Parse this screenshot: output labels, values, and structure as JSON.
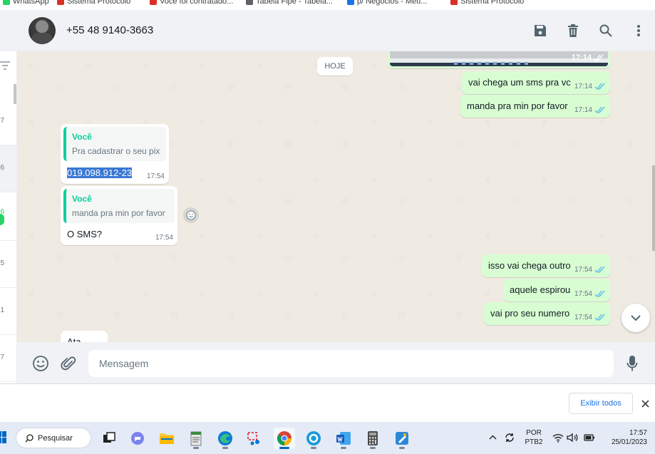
{
  "bookmarks": [
    {
      "label": "WhatsApp",
      "color": "#25d366"
    },
    {
      "label": "Sistema Protocolo",
      "color": "#d93025"
    },
    {
      "label": "Voce foi contratado...",
      "color": "#d93025"
    },
    {
      "label": "Tabela Fipe - Tabela...",
      "color": "#5f6368"
    },
    {
      "label": "p/ Negocios - Meu...",
      "color": "#1a73e8"
    },
    {
      "label": "Sistema Protocolo",
      "color": "#d93025"
    }
  ],
  "chat_list": {
    "times": [
      "7",
      "6",
      "6",
      "5",
      "1",
      "7"
    ]
  },
  "header": {
    "contact": "+55 48 9140-3663"
  },
  "chat": {
    "date_pill": "HOJE",
    "image_msg": {
      "time": "17:14"
    },
    "messages": [
      {
        "dir": "out",
        "text": "vai chega um sms pra vc",
        "time": "17:14"
      },
      {
        "dir": "out",
        "text": "manda pra min por favor",
        "time": "17:14"
      },
      {
        "dir": "in",
        "quote_author": "Você",
        "quote_text": "Pra cadastrar o seu pix",
        "text": "019.098.912-23",
        "time": "17:54"
      },
      {
        "dir": "in",
        "quote_author": "Você",
        "quote_text": "manda pra min por favor",
        "text": "O SMS?",
        "time": "17:54"
      },
      {
        "dir": "out",
        "text": "isso vai chega outro",
        "time": "17:54"
      },
      {
        "dir": "out",
        "text": "aquele espirou",
        "time": "17:54"
      },
      {
        "dir": "out",
        "text": "vai pro seu numero",
        "time": "17:54"
      },
      {
        "dir": "in",
        "text": "Ata"
      }
    ]
  },
  "footer": {
    "placeholder": "Mensagem"
  },
  "download_bar": {
    "show_all": "Exibir todos"
  },
  "taskbar": {
    "search": "Pesquisar",
    "lang_top": "POR",
    "lang_bottom": "PTB2",
    "time": "17:57",
    "date": "25/01/2023"
  },
  "colors": {
    "accent_green": "#06cf9c",
    "outgoing_bubble": "#d9fdd3",
    "tick_blue": "#53bdeb",
    "chat_bg": "#efeae2"
  }
}
